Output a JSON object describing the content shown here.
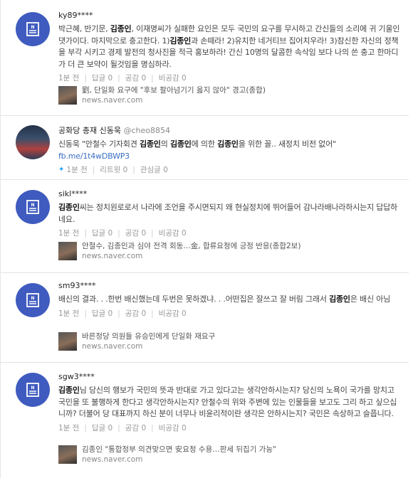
{
  "posts": [
    {
      "author": "ky89****",
      "body": [
        {
          "t": "박근혜, 반기문, "
        },
        {
          "t": "김종인",
          "hl": true
        },
        {
          "t": ", 이재명씨가 실패한 요인은 모두 국민의 요구를 무시하고 간신들의 소리에 귀 기울인 댓가이다. 마지막으로 충고한다. 1)"
        },
        {
          "t": "김종인",
          "hl": true
        },
        {
          "t": "과 손떼라! 2)유치한 네거티브 집어치우라! 3)참신한 자신의 정책을 부각 시키고 경제 발전의 청사진을 적극 홍보하라! 간신 10명의 달콤한 속삭임 보다 나의 쓴 충고 한마디가 더 큰 보약이 될것임을 명심하라."
        }
      ],
      "time": "1분 전",
      "reply": "답글 0",
      "like": "공감 0",
      "dislike": "비공감 0",
      "news_title": "劉, 단일화 요구에 \"후보 팔아넘기기 옳지 않아\" 경고(종합)",
      "news_source": "news.naver.com"
    },
    {
      "author": "공화당 총재 신동욱",
      "handle": "@cheo8854",
      "body": [
        {
          "t": "신동욱 \"안철수 기자회견 "
        },
        {
          "t": "김종인",
          "hl": true
        },
        {
          "t": "의 "
        },
        {
          "t": "김종인",
          "hl": true
        },
        {
          "t": "에 의한 "
        },
        {
          "t": "김종인",
          "hl": true
        },
        {
          "t": "을 위한 꼴.. 새정치 비전 없어\" "
        },
        {
          "t": "fb.me/1t4wDBWP3",
          "link": true
        }
      ],
      "time": "1분 전",
      "retweet": "리트윗 0",
      "interest": "관심글 0"
    },
    {
      "author": "sikl****",
      "body": [
        {
          "t": "김종인",
          "hl": true
        },
        {
          "t": "씨는 정치원로로서 나라에 조언을 주시면되지 왜 현실정치에 뛰어들어 감나라배나라하시는지 답답하네요."
        }
      ],
      "time": "1분 전",
      "reply": "답글 0",
      "like": "공감 0",
      "dislike": "비공감 0",
      "news_title": "안철수, 김종인과 심야 전격 회동…金, 합류요청에 긍정 반응(종합2보)",
      "news_source": "news.naver.com"
    },
    {
      "author": "sm93****",
      "body": [
        {
          "t": "배신의 결과. . .한번 배신했는데 두번은 못하겠냐. . .어떤집은 잘쓰고 잘 버림 그래서 "
        },
        {
          "t": "김종인",
          "hl": true
        },
        {
          "t": "은 배신 아님"
        }
      ],
      "time": "1분 전",
      "reply": "답글 0",
      "like": "공감 0",
      "dislike": "비공감 0",
      "news_title": "바른정당 의원들 유승민에게 단일화 재요구",
      "news_source": "news.naver.com"
    },
    {
      "author": "sgw3****",
      "body": [
        {
          "t": "김종인",
          "hl": true
        },
        {
          "t": "님 당신의 행보가 국민의 뜻과 반대로 가고 있다고는 생각안하시는지? 당신의 노욕이 국가를 망치고 국민을 또 불행하게 한다고 생각안하시는지? 안철수의 위와 주변에 있는 인물들을 보고도 그리 하고 싶으십니까? 더불어 당 대표까지 하신 분이 너무나 비윤리적이란 생각은 안하시는지? 국민은 속상하고 슬픕니다."
        }
      ],
      "time": "1분 전",
      "reply": "답글 0",
      "like": "공감 0",
      "dislike": "비공감 0",
      "news_title": "김종인 \"통합정부 의견맞으면 安요청 수용…판세 뒤집기 가능\"",
      "news_source": "news.naver.com"
    }
  ]
}
